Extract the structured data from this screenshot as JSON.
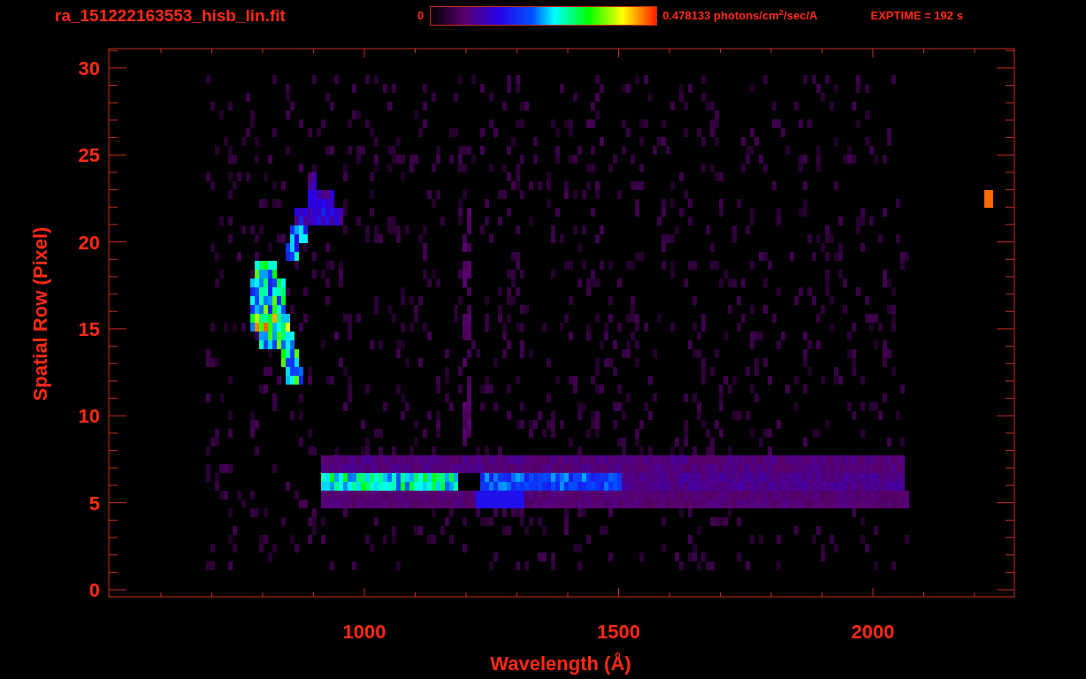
{
  "header": {
    "filename": "ra_151222163553_hisb_lin.fit",
    "colorbar": {
      "min_label": "0",
      "max_label": "0.478133 photons/cm$^{2}$/sec/A"
    },
    "exposure": "EXPTIME = 192 s"
  },
  "plot": {
    "xlabel": "Wavelength (Å)",
    "ylabel": "Spatial Row (Pixel)",
    "xticks": [
      "1000",
      "1500",
      "2000"
    ],
    "yticks": [
      "30",
      "25",
      "20",
      "15",
      "10",
      "5",
      "0"
    ]
  }
}
